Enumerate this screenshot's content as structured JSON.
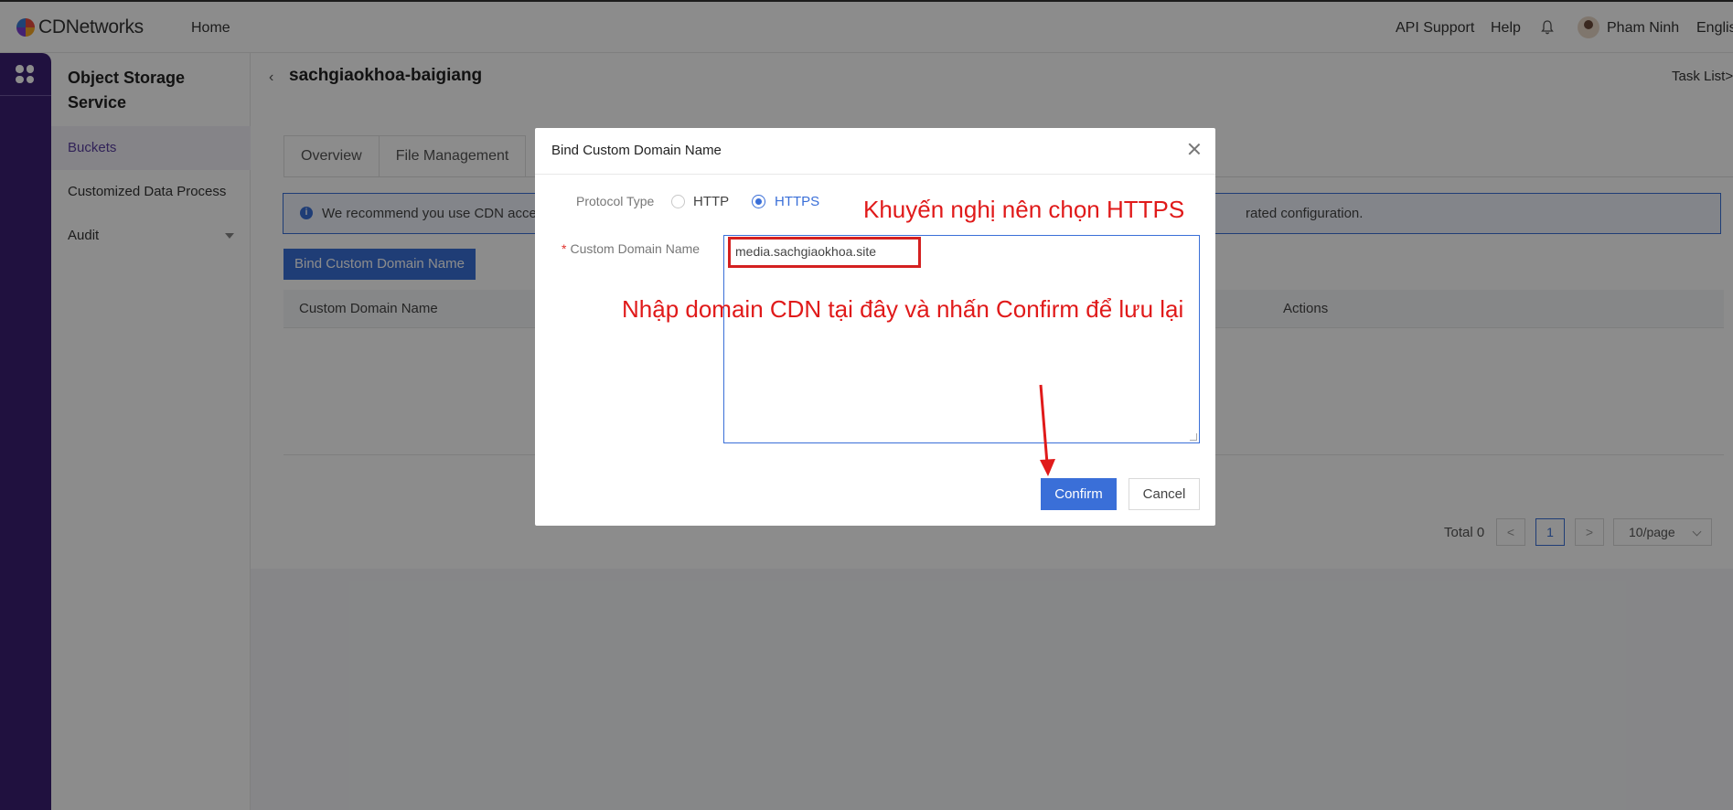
{
  "topbar": {
    "logo_text": "CDNetworks",
    "nav_home": "Home",
    "api_support": "API Support",
    "help": "Help",
    "user_name": "Pham Ninh",
    "language": "English"
  },
  "sidebar": {
    "title": "Object Storage Service",
    "items": [
      {
        "label": "Buckets",
        "active": true
      },
      {
        "label": "Customized Data Process",
        "active": false
      },
      {
        "label": "Audit",
        "active": false
      }
    ]
  },
  "main": {
    "bucket_title": "sachgiaokhoa-baigiang",
    "task_list": "Task List>>",
    "tabs": [
      "Overview",
      "File Management"
    ],
    "notice_text": "We recommend you use CDN accele",
    "notice_text_end": "rated configuration.",
    "bind_button": "Bind Custom Domain Name",
    "table_headers": [
      "Custom Domain Name",
      "Actions"
    ],
    "pagination": {
      "total": "Total 0",
      "prev": "<",
      "current_page": "1",
      "next": ">",
      "page_size": "10/page"
    }
  },
  "modal": {
    "title": "Bind Custom Domain Name",
    "protocol_label": "Protocol Type",
    "protocol_options": [
      "HTTP",
      "HTTPS"
    ],
    "protocol_selected": "HTTPS",
    "domain_label": "Custom Domain Name",
    "domain_required_mark": "*",
    "domain_value": "media.sachgiaokhoa.site",
    "confirm": "Confirm",
    "cancel": "Cancel"
  },
  "annotations": {
    "https_note": "Khuyến nghị nên chọn HTTPS",
    "confirm_note": "Nhập domain CDN tại đây và nhấn Confirm để lưu lại"
  },
  "colors": {
    "rail": "#3b1f73",
    "primary": "#3a6fd8",
    "annotation": "#e01a1a"
  }
}
